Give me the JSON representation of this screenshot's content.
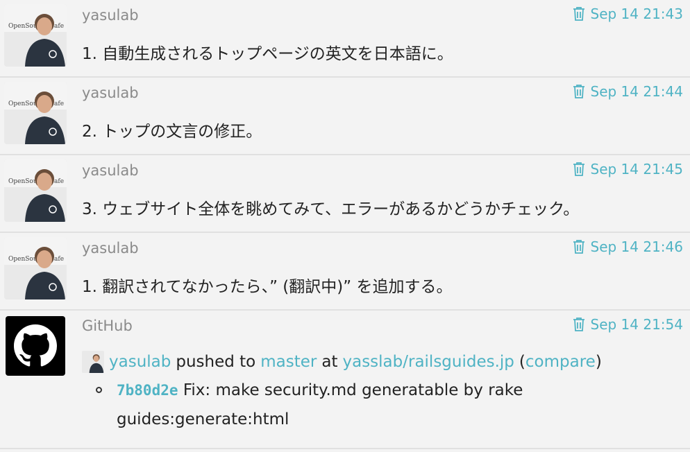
{
  "messages": [
    {
      "author": "yasulab",
      "time": "Sep 14 21:43",
      "text": "1. 自動生成されるトップページの英文を日本語に。"
    },
    {
      "author": "yasulab",
      "time": "Sep 14 21:44",
      "text": "2. トップの文言の修正。"
    },
    {
      "author": "yasulab",
      "time": "Sep 14 21:45",
      "text": "3. ウェブサイト全体を眺めてみて、エラーがあるかどうかチェック。"
    },
    {
      "author": "yasulab",
      "time": "Sep 14 21:46",
      "text": "1. 翻訳されてなかったら、” (翻訳中)” を追加する。"
    }
  ],
  "github": {
    "author": "GitHub",
    "time": "Sep 14 21:54",
    "pusher": "yasulab",
    "pushed_to": "pushed to",
    "branch": "master",
    "at": "at",
    "repo": "yasslab/railsguides.jp",
    "paren_open": "(",
    "compare": "compare",
    "paren_close": ")",
    "commit_sha": "7b80d2e",
    "commit_msg": "Fix: make security.md generatable by rake guides:generate:html"
  },
  "colors": {
    "link": "#4fb3c4",
    "author": "#8a8a8a",
    "background": "#f3f3f3"
  },
  "icons": {
    "delete": "trash-icon",
    "github": "github-octocat-icon"
  }
}
